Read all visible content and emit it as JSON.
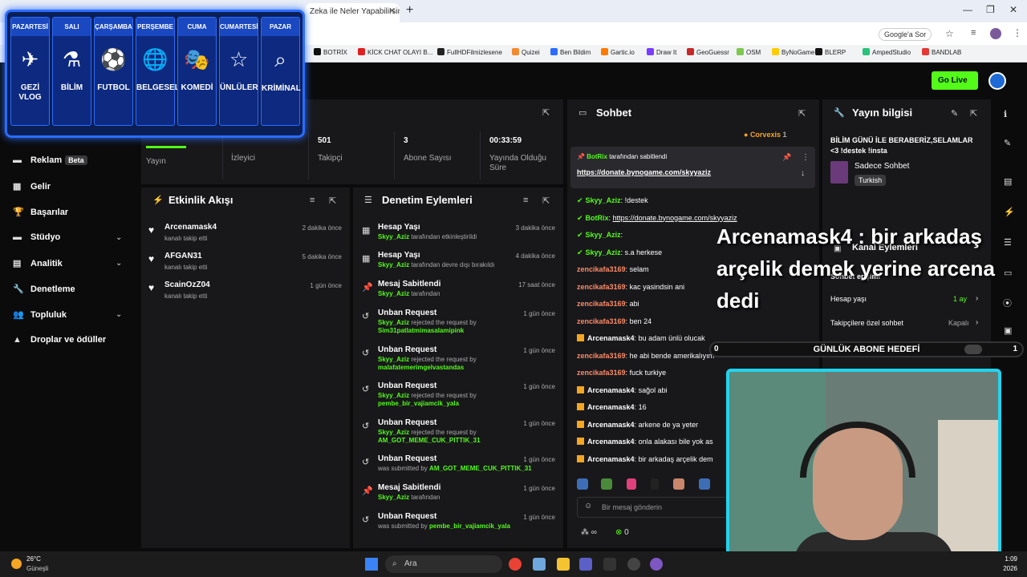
{
  "browser": {
    "tab_title": "Zeka ile Neler Yapabilirsin",
    "google_label": "Google'a Sor",
    "bookmarks": [
      {
        "label": "BOTRİX",
        "color": "#111111"
      },
      {
        "label": "KİCK CHAT OLAYI B...",
        "color": "#e02020"
      },
      {
        "label": "FullHDFilmizlesene",
        "color": "#222222"
      },
      {
        "label": "Quizei",
        "color": "#f28b30"
      },
      {
        "label": "Ben Bildim",
        "color": "#2b6cff"
      },
      {
        "label": "Gartic.io",
        "color": "#ff7a00"
      },
      {
        "label": "Draw It",
        "color": "#7a3cff"
      },
      {
        "label": "GeoGuessr",
        "color": "#c62828"
      },
      {
        "label": "OSM",
        "color": "#7ec850"
      },
      {
        "label": "ByNoGame",
        "color": "#ffcc00"
      },
      {
        "label": "BLERP",
        "color": "#111111"
      },
      {
        "label": "AmpedStudio",
        "color": "#29c27a"
      },
      {
        "label": "BANDLAB",
        "color": "#e53935"
      }
    ]
  },
  "header": {
    "go_live": "Go Live"
  },
  "schedule": [
    {
      "day": "PAZARTESİ",
      "label": "GEZİ VLOG",
      "icon": "✈"
    },
    {
      "day": "SALI",
      "label": "BİLİM",
      "icon": "⚗"
    },
    {
      "day": "ÇARŞAMBA",
      "label": "FUTBOL",
      "icon": "⚽"
    },
    {
      "day": "PERŞEMBE",
      "label": "BELGESEL",
      "icon": "🌐"
    },
    {
      "day": "CUMA",
      "label": "KOMEDİ",
      "icon": "🎭"
    },
    {
      "day": "CUMARTESİ",
      "label": "ÜNLÜLER",
      "icon": "☆"
    },
    {
      "day": "PAZAR",
      "label": "KRİMİNAL",
      "icon": "⌕"
    }
  ],
  "stats": {
    "yayin": "Yayın",
    "izleyici": "İzleyici",
    "takipci_value": "501",
    "takipci": "Takipçi",
    "abone_value": "3",
    "abone": "Abone Sayısı",
    "sure_value": "00:33:59",
    "sure": "Yayında Olduğu Süre"
  },
  "sidebar": [
    {
      "label": "Reklam",
      "badge": "Beta",
      "icon": "▬"
    },
    {
      "label": "Gelir",
      "icon": "▦"
    },
    {
      "label": "Başarılar",
      "icon": "🏆"
    },
    {
      "label": "Stüdyo",
      "icon": "▬"
    },
    {
      "label": "Analitik",
      "icon": "▤"
    },
    {
      "label": "Denetleme",
      "icon": "🔧"
    },
    {
      "label": "Topluluk",
      "icon": "👥"
    },
    {
      "label": "Droplar ve ödüller",
      "icon": "▲"
    }
  ],
  "feed": {
    "title": "Etkinlik Akışı",
    "items": [
      {
        "name": "Arcenamask4",
        "sub": "kanalı takip etti",
        "time": "2 dakika önce"
      },
      {
        "name": "AFGAN31",
        "sub": "kanalı takip etti",
        "time": "5 dakika önce"
      },
      {
        "name": "ScainOzZ04",
        "sub": "kanalı takip etti",
        "time": "1 gün önce"
      }
    ]
  },
  "moderation": {
    "title": "Denetim Eylemleri",
    "items": [
      {
        "title": "Hesap Yaşı",
        "user": "Skyy_Aziz",
        "text": "tarafından etkinleştirildi",
        "user2": "",
        "time": "3 dakika önce",
        "icon": "▦"
      },
      {
        "title": "Hesap Yaşı",
        "user": "Skyy_Aziz",
        "text": "tarafından devre dışı bırakıldı",
        "user2": "",
        "time": "4 dakika önce",
        "icon": "▦"
      },
      {
        "title": "Mesaj Sabitlendi",
        "user": "Skyy_Aziz",
        "text": "tarafından",
        "user2": "",
        "time": "17 saat önce",
        "icon": "📌"
      },
      {
        "title": "Unban Request",
        "user": "Skyy_Aziz",
        "text": "rejected the request by",
        "user2": "Sim31patlatmimasalamipink",
        "time": "1 gün önce",
        "icon": "↺"
      },
      {
        "title": "Unban Request",
        "user": "Skyy_Aziz",
        "text": "rejected the request by",
        "user2": "malafatemerimgelvastandas",
        "time": "1 gün önce",
        "icon": "↺"
      },
      {
        "title": "Unban Request",
        "user": "Skyy_Aziz",
        "text": "rejected the request by",
        "user2": "pembe_bir_vajiamcik_yala",
        "time": "1 gün önce",
        "icon": "↺"
      },
      {
        "title": "Unban Request",
        "user": "Skyy_Aziz",
        "text": "rejected the request by",
        "user2": "AM_GOT_MEME_CUK_PITTIK_31",
        "time": "1 gün önce",
        "icon": "↺"
      },
      {
        "title": "Unban Request",
        "user": "",
        "text": "was submitted by",
        "user2": "AM_GOT_MEME_CUK_PITTIK_31",
        "time": "1 gün önce",
        "icon": "↺"
      },
      {
        "title": "Mesaj Sabitlendi",
        "user": "Skyy_Aziz",
        "text": "tarafından",
        "user2": "",
        "time": "1 gün önce",
        "icon": "📌"
      },
      {
        "title": "Unban Request",
        "user": "",
        "text": "was submitted by",
        "user2": "pembe_bir_vajiamcik_yala",
        "time": "1 gün önce",
        "icon": "↺"
      }
    ]
  },
  "chat": {
    "title": "Sohbet",
    "top_user": "Corvexis",
    "top_count": "1",
    "pinned_by": "BotRix",
    "pinned_by_suffix": "tarafından sabitlendi",
    "pinned_link": "https://donate.bynogame.com/skyyaziz",
    "messages": [
      {
        "user": "Skyy_Aziz",
        "text": "!destek",
        "color": "#53fc18"
      },
      {
        "user": "BotRix",
        "text": "https://donate.bynogame.com/skyyaziz",
        "color": "#53fc18"
      },
      {
        "user": "Skyy_Aziz",
        "text": "",
        "color": "#53fc18"
      },
      {
        "user": "Skyy_Aziz",
        "text": "s.a herkese",
        "color": "#53fc18"
      },
      {
        "user": "zencikafa3169",
        "text": "selam",
        "color": "#ff8a65"
      },
      {
        "user": "zencikafa3169",
        "text": "kac yasindsin ani",
        "color": "#ff8a65"
      },
      {
        "user": "zencikafa3169",
        "text": "abi",
        "color": "#ff8a65"
      },
      {
        "user": "zencikafa3169",
        "text": "ben 24",
        "color": "#ff8a65"
      },
      {
        "user": "Arcenamask4",
        "text": "bu adam ünlü olucak",
        "color": "#ffffff"
      },
      {
        "user": "zencikafa3169",
        "text": "he abi bende amerikalıyım",
        "color": "#ff8a65"
      },
      {
        "user": "zencikafa3169",
        "text": "fuck turkiye",
        "color": "#ff8a65"
      },
      {
        "user": "Arcenamask4",
        "text": "sağol abi",
        "color": "#ffffff"
      },
      {
        "user": "Arcenamask4",
        "text": "16",
        "color": "#ffffff"
      },
      {
        "user": "Arcenamask4",
        "text": "arkene de ya yeter",
        "color": "#ffffff"
      },
      {
        "user": "Arcenamask4",
        "text": "onla alakası bile yok as",
        "color": "#ffffff"
      },
      {
        "user": "Arcenamask4",
        "text": "bir arkadaş arçelik dem",
        "color": "#ffffff"
      }
    ],
    "input_placeholder": "Bir mesaj gönderin",
    "count_a": "∞",
    "count_b": "0"
  },
  "info": {
    "title": "Yayın bilgisi",
    "stream_title": "BİLİM GÜNÜ İLE BERABERİZ,SELAMLAR <3 !destek !insta",
    "category": "Sadece Sohbet",
    "tag": "Turkish",
    "channel_actions": "Kanal Eylemleri",
    "chat_access": "Sohbet erişimi",
    "account_age": "Hesap yaşı",
    "account_age_value": "1 ay",
    "followers_only": "Takipçilere özel sohbet",
    "followers_only_value": "Kapalı"
  },
  "overlay": {
    "big_text": "Arcenamask4 : bir arkadaş arçelik demek yerine arcena dedi",
    "goal_label": "GÜNLÜK ABONE HEDEFİ",
    "goal_left": "0",
    "goal_right": "1"
  },
  "taskbar": {
    "weather_temp": "26°C",
    "weather_text": "Güneşli",
    "search": "Ara",
    "time": "1:09",
    "date": "2026"
  }
}
